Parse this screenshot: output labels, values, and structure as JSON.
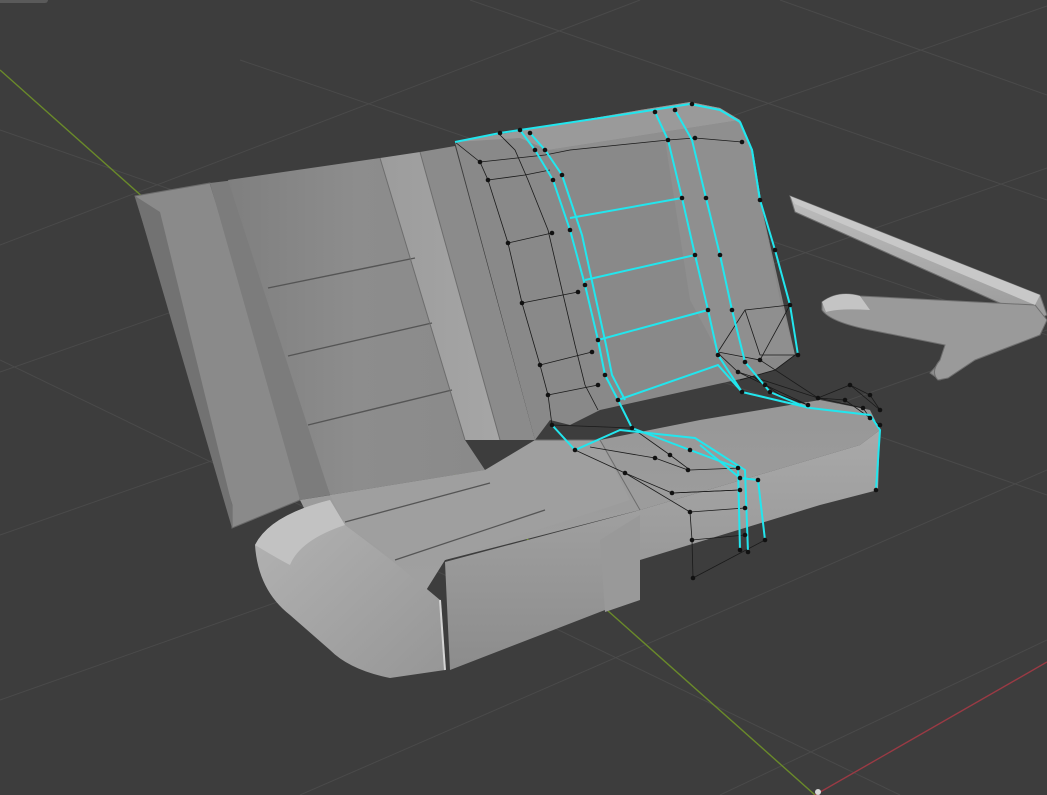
{
  "viewport": {
    "background_color": "#3d3d3d",
    "grid_color": "#4a4a4a",
    "axis_y_color": "#6a8a2a",
    "axis_x_color": "#9a3a44",
    "selection_color": "#22e6ee",
    "vertex_color": "#111111",
    "mesh_base_color": "#8e8e8e"
  },
  "scene": {
    "objects": [
      "bench-seat",
      "armrest"
    ],
    "selected_part": "right-half-edge-loops"
  }
}
